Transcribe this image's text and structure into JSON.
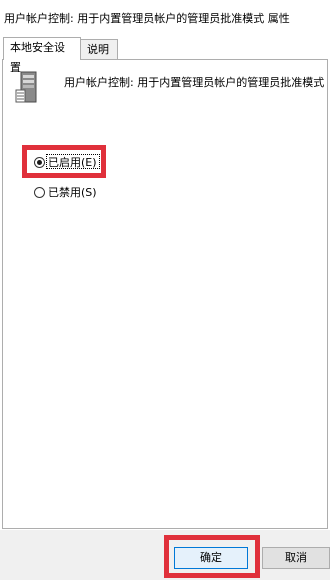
{
  "window": {
    "title": "用户帐户控制: 用于内置管理员帐户的管理员批准模式 属性"
  },
  "tabs": [
    {
      "label": "本地安全设置",
      "active": true
    },
    {
      "label": "说明",
      "active": false
    }
  ],
  "policy": {
    "icon": "server-policy-icon",
    "name": "用户帐户控制: 用于内置管理员帐户的管理员批准模式"
  },
  "options": [
    {
      "label": "已启用(E)",
      "checked": true
    },
    {
      "label": "已禁用(S)",
      "checked": false
    }
  ],
  "buttons": {
    "ok": "确定",
    "cancel": "取消"
  },
  "colors": {
    "highlight": "#e0303b",
    "default_button_border": "#0078d7"
  }
}
